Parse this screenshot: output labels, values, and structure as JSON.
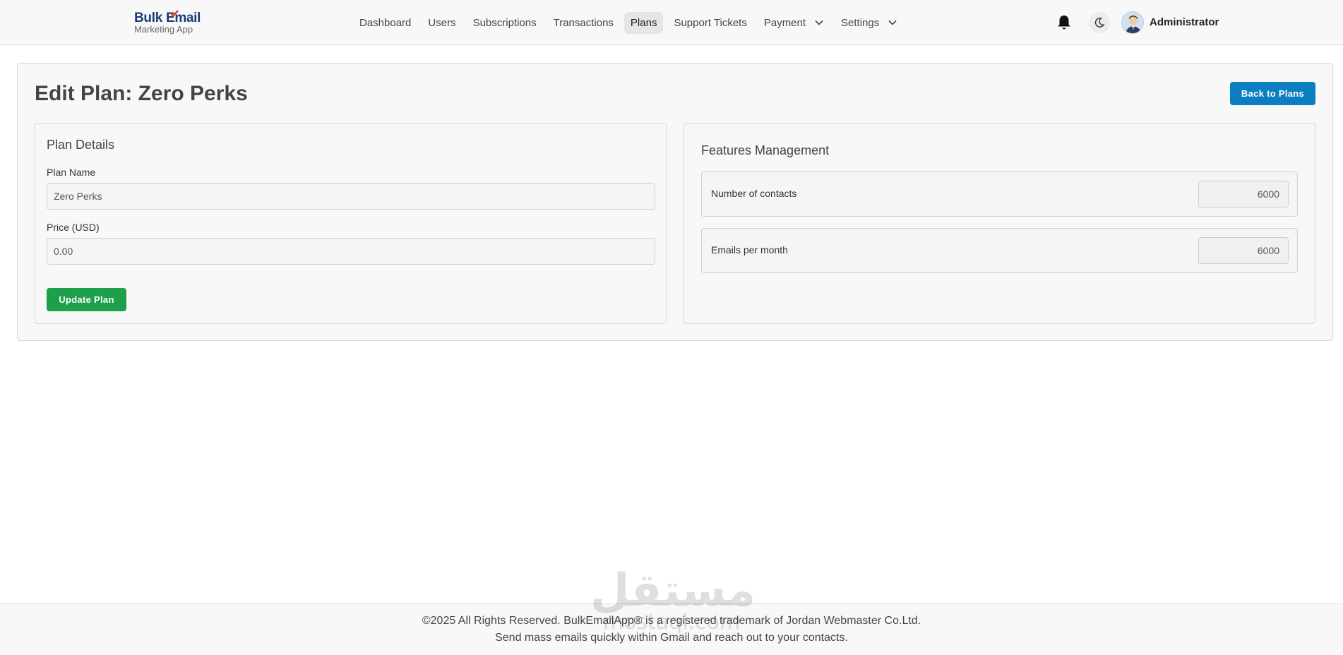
{
  "brand": {
    "line1": "Bulk Email",
    "line2": "Marketing App"
  },
  "nav": {
    "items": [
      {
        "label": "Dashboard"
      },
      {
        "label": "Users"
      },
      {
        "label": "Subscriptions"
      },
      {
        "label": "Transactions"
      },
      {
        "label": "Plans",
        "active": true
      },
      {
        "label": "Support Tickets"
      },
      {
        "label": "Payment",
        "dropdown": true
      },
      {
        "label": "Settings",
        "dropdown": true
      }
    ],
    "user_name": "Administrator",
    "icons": [
      "bell-icon",
      "moon-icon",
      "avatar"
    ]
  },
  "page": {
    "title": "Edit Plan: Zero Perks",
    "back_label": "Back to Plans"
  },
  "plan_details": {
    "heading": "Plan Details",
    "name_label": "Plan Name",
    "name_value": "Zero Perks",
    "price_label": "Price (USD)",
    "price_value": "0.00",
    "submit_label": "Update Plan"
  },
  "features": {
    "heading": "Features Management",
    "rows": [
      {
        "label": "Number of contacts",
        "value": "6000"
      },
      {
        "label": "Emails per month",
        "value": "6000"
      }
    ]
  },
  "footer": {
    "line1": "©2025 All Rights Reserved. BulkEmailApp® is a registered trademark of Jordan Webmaster Co.Ltd.",
    "line2": "Send mass emails quickly within Gmail and reach out to your contacts."
  },
  "watermark": {
    "arabic": "مستقل",
    "latin": "mostaql.com"
  },
  "colors": {
    "primary": "#0b7ec2",
    "success": "#1ea04b",
    "brand": "#1e3a7a",
    "check_accent": "#d93025"
  }
}
